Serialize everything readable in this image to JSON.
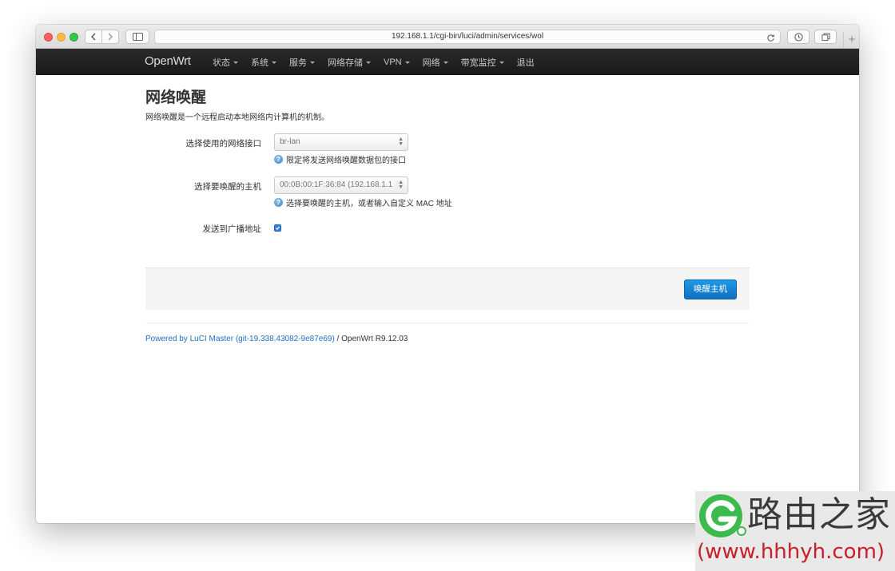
{
  "browser": {
    "url": "192.168.1.1/cgi-bin/luci/admin/services/wol",
    "icons": {
      "back": "chevron-left-icon",
      "forward": "chevron-right-icon",
      "sidebar": "sidebar-icon",
      "reload": "reload-icon",
      "history": "clock-icon",
      "tabs": "tabs-icon",
      "new_tab": "plus-icon"
    },
    "new_tab_label": "+"
  },
  "navbar": {
    "brand": "OpenWrt",
    "items": [
      {
        "label": "状态",
        "dropdown": true
      },
      {
        "label": "系统",
        "dropdown": true
      },
      {
        "label": "服务",
        "dropdown": true
      },
      {
        "label": "网络存储",
        "dropdown": true
      },
      {
        "label": "VPN",
        "dropdown": true
      },
      {
        "label": "网络",
        "dropdown": true
      },
      {
        "label": "带宽监控",
        "dropdown": true
      },
      {
        "label": "退出",
        "dropdown": false
      }
    ]
  },
  "page": {
    "title": "网络唤醒",
    "description": "网络唤醒是一个远程启动本地网络内计算机的机制。"
  },
  "form": {
    "interface": {
      "label": "选择使用的网络接口",
      "value": "br-lan",
      "help": "限定将发送网络唤醒数据包的接口"
    },
    "host": {
      "label": "选择要唤醒的主机",
      "value": "00:0B:00:1F:36:84 (192.168.1.1",
      "help": "选择要唤醒的主机，或者输入自定义 MAC 地址"
    },
    "broadcast": {
      "label": "发送到广播地址",
      "checked": true
    }
  },
  "actions": {
    "wake_button": "唤醒主机"
  },
  "footer": {
    "powered_by": "Powered by LuCI Master (git-19.338.43082-9e87e69)",
    "separator": " / ",
    "version": "OpenWrt R9.12.03"
  },
  "watermark": {
    "brand_text": "路由之家",
    "url_text": "(www.hhhyh.com)"
  },
  "colors": {
    "navbar_bg": "#222222",
    "primary_button": "#1a84d6",
    "link": "#1c6fc7",
    "watermark_green": "#3dba4e",
    "watermark_red": "#c8202a"
  }
}
